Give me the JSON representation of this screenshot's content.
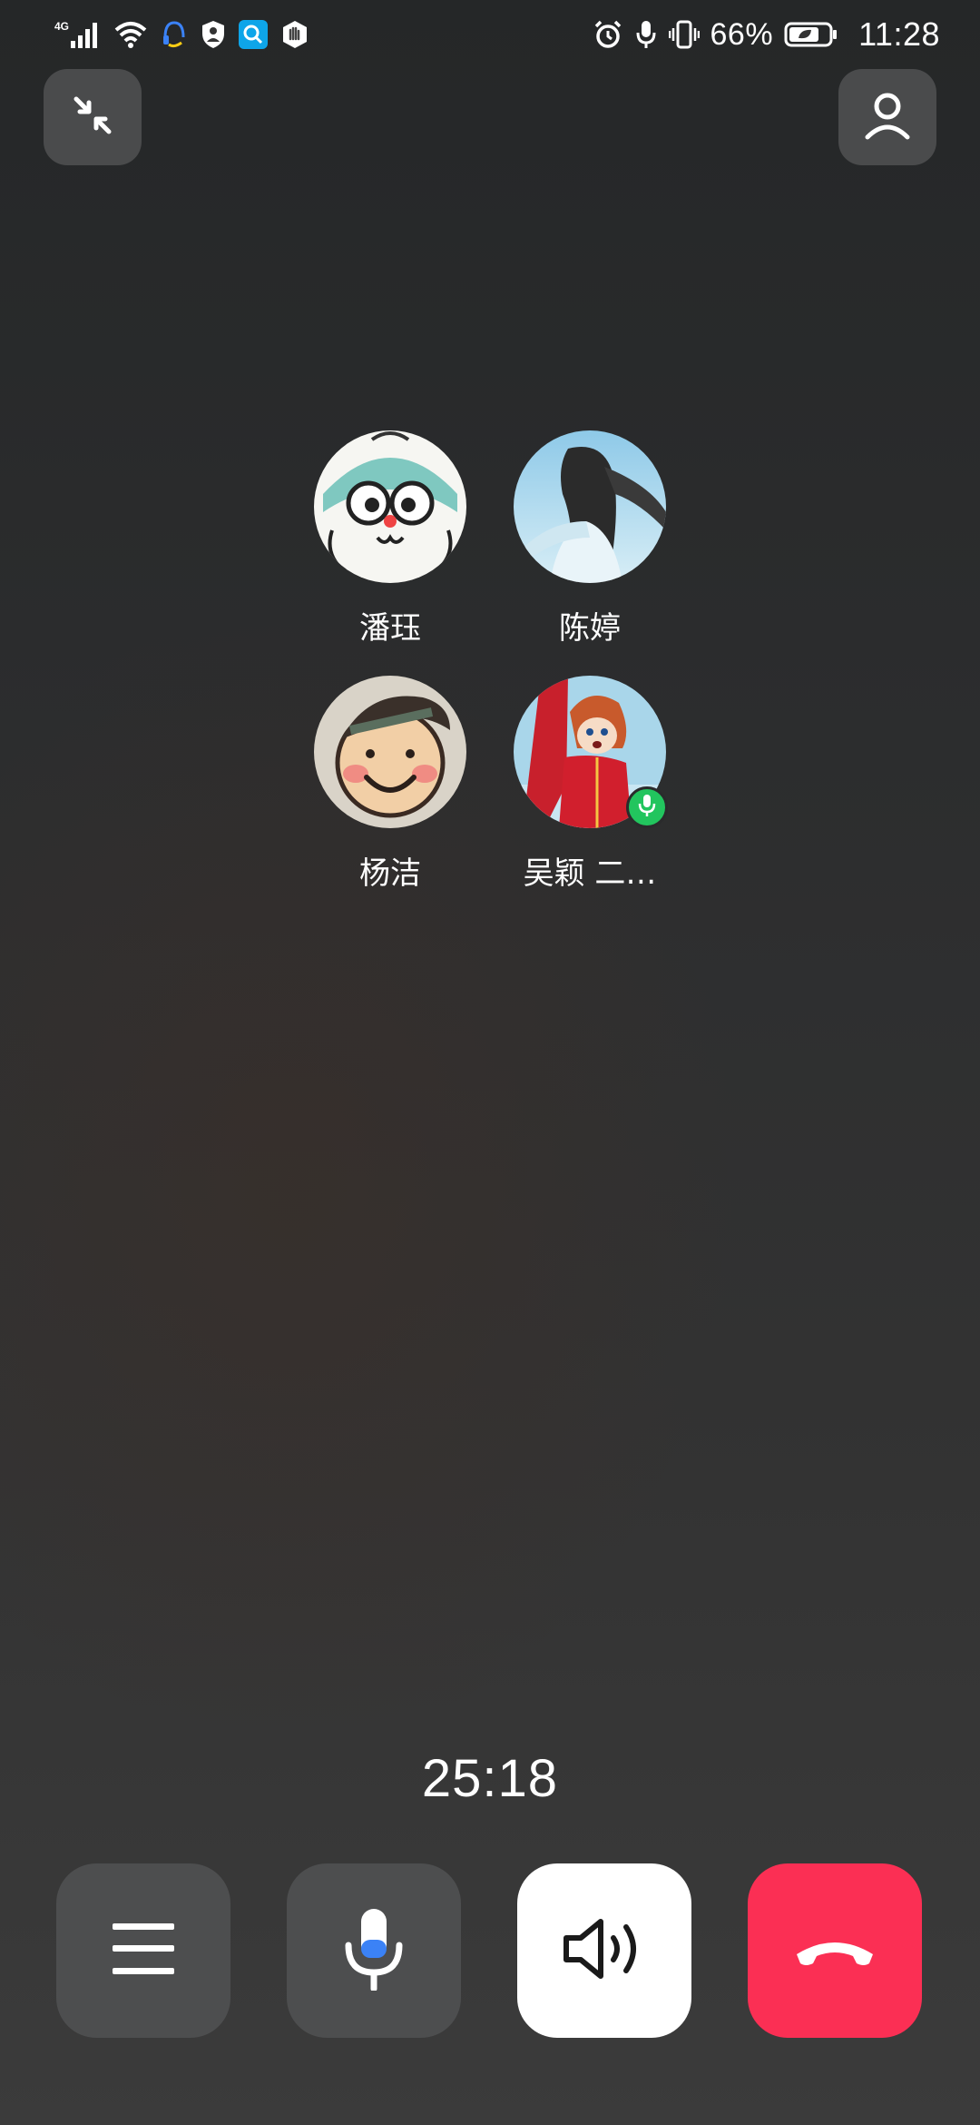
{
  "status_bar": {
    "network": "4G",
    "battery": "66%",
    "time": "11:28",
    "left_icons": [
      "signal-icon",
      "wifi-icon",
      "headset-app-icon",
      "shield-person-icon",
      "search-app-icon",
      "hand-app-icon"
    ],
    "right_icons": [
      "alarm-icon",
      "microphone-status-icon",
      "vibrate-icon",
      "battery-icon"
    ]
  },
  "top_actions": {
    "minimize_icon": "shrink-arrows-icon",
    "add_member_icon": "person-icon"
  },
  "participants": [
    {
      "name": "潘珏",
      "avatar": "cartoon-cat-avatar",
      "speaking": false
    },
    {
      "name": "陈婷",
      "avatar": "girl-sky-avatar",
      "speaking": false
    },
    {
      "name": "杨洁",
      "avatar": "smiley-hat-avatar",
      "speaking": false
    },
    {
      "name": "吴颖 二…",
      "avatar": "anime-girl-avatar",
      "speaking": true
    }
  ],
  "call": {
    "duration": "25:18"
  },
  "controls": {
    "menu_icon": "menu-icon",
    "mic_icon": "microphone-icon",
    "speaker_icon": "speaker-icon",
    "hangup_icon": "hang-up-icon",
    "speaker_active": true,
    "colors": {
      "hangup": "#fb2f54",
      "speaking_badge": "#22c55e",
      "mic_accent": "#3b82f6"
    }
  }
}
